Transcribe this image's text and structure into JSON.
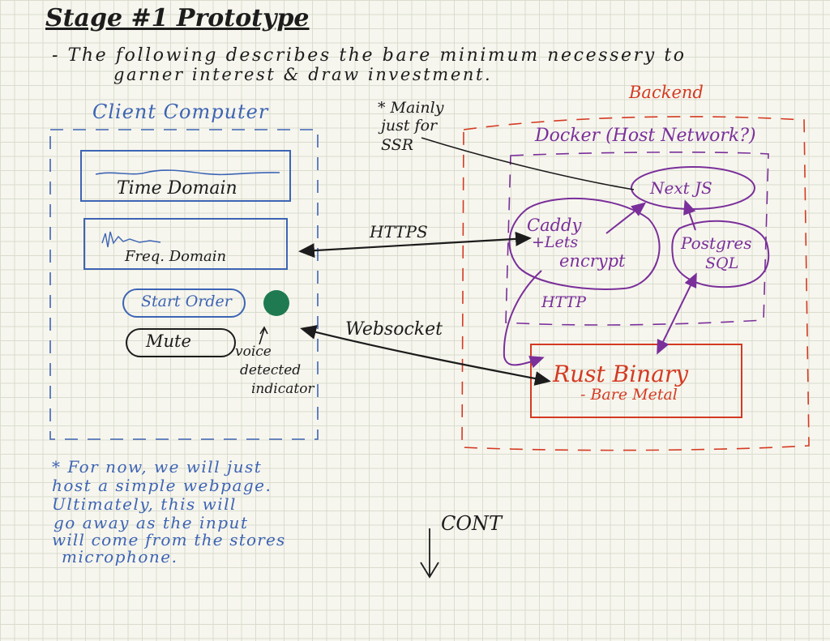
{
  "title": "Stage #1 Prototype",
  "intro": {
    "line1": "- The following describes the bare minimum necessery to",
    "line2": "garner interest & draw investment."
  },
  "client": {
    "label": "Client Computer",
    "time_domain": "Time Domain",
    "freq_domain": "Freq. Domain",
    "start_order": "Start Order",
    "mute": "Mute",
    "indicator_note": [
      "voice",
      "detected",
      "indicator"
    ],
    "indicator_color": "#1f7a52"
  },
  "ssr_note": [
    "* Mainly",
    "just for",
    "SSR"
  ],
  "backend": {
    "label": "Backend",
    "docker": "Docker (Host Network?)",
    "nextjs": "Next JS",
    "caddy": [
      "Caddy",
      "+Lets",
      "encrypt"
    ],
    "postgres": [
      "Postgres",
      "SQL"
    ],
    "http": "HTTP",
    "rust": "Rust Binary",
    "rust_sub": "- Bare Metal"
  },
  "connections": {
    "https": "HTTPS",
    "websocket": "Websocket"
  },
  "footnote": [
    "* For now, we will just",
    "host a simple webpage.",
    "Ultimately, this will",
    "go away as the input",
    "will come from the stores",
    "microphone."
  ],
  "cont": "CONT",
  "colors": {
    "ink": "#1c1c1c",
    "client_blue": "#3d64b4",
    "backend_red": "#d43a22",
    "docker_purple": "#7a2f9a",
    "indicator_green": "#1f7a52"
  }
}
